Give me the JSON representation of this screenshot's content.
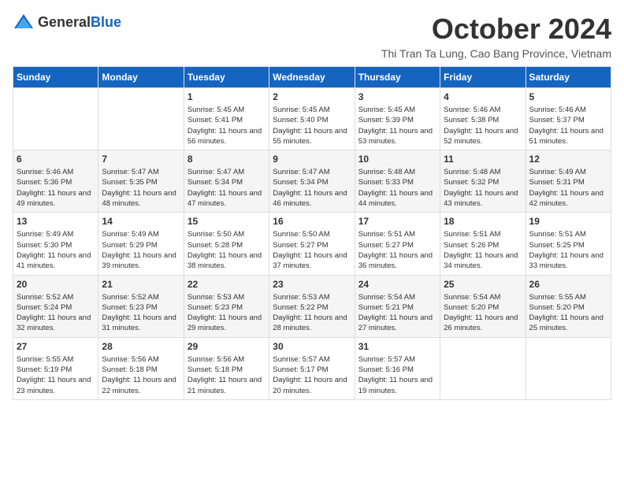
{
  "logo": {
    "general": "General",
    "blue": "Blue"
  },
  "header": {
    "month": "October 2024",
    "location": "Thi Tran Ta Lung, Cao Bang Province, Vietnam"
  },
  "days_of_week": [
    "Sunday",
    "Monday",
    "Tuesday",
    "Wednesday",
    "Thursday",
    "Friday",
    "Saturday"
  ],
  "weeks": [
    [
      {
        "day": "",
        "info": ""
      },
      {
        "day": "",
        "info": ""
      },
      {
        "day": "1",
        "info": "Sunrise: 5:45 AM\nSunset: 5:41 PM\nDaylight: 11 hours and 56 minutes."
      },
      {
        "day": "2",
        "info": "Sunrise: 5:45 AM\nSunset: 5:40 PM\nDaylight: 11 hours and 55 minutes."
      },
      {
        "day": "3",
        "info": "Sunrise: 5:45 AM\nSunset: 5:39 PM\nDaylight: 11 hours and 53 minutes."
      },
      {
        "day": "4",
        "info": "Sunrise: 5:46 AM\nSunset: 5:38 PM\nDaylight: 11 hours and 52 minutes."
      },
      {
        "day": "5",
        "info": "Sunrise: 5:46 AM\nSunset: 5:37 PM\nDaylight: 11 hours and 51 minutes."
      }
    ],
    [
      {
        "day": "6",
        "info": "Sunrise: 5:46 AM\nSunset: 5:36 PM\nDaylight: 11 hours and 49 minutes."
      },
      {
        "day": "7",
        "info": "Sunrise: 5:47 AM\nSunset: 5:35 PM\nDaylight: 11 hours and 48 minutes."
      },
      {
        "day": "8",
        "info": "Sunrise: 5:47 AM\nSunset: 5:34 PM\nDaylight: 11 hours and 47 minutes."
      },
      {
        "day": "9",
        "info": "Sunrise: 5:47 AM\nSunset: 5:34 PM\nDaylight: 11 hours and 46 minutes."
      },
      {
        "day": "10",
        "info": "Sunrise: 5:48 AM\nSunset: 5:33 PM\nDaylight: 11 hours and 44 minutes."
      },
      {
        "day": "11",
        "info": "Sunrise: 5:48 AM\nSunset: 5:32 PM\nDaylight: 11 hours and 43 minutes."
      },
      {
        "day": "12",
        "info": "Sunrise: 5:49 AM\nSunset: 5:31 PM\nDaylight: 11 hours and 42 minutes."
      }
    ],
    [
      {
        "day": "13",
        "info": "Sunrise: 5:49 AM\nSunset: 5:30 PM\nDaylight: 11 hours and 41 minutes."
      },
      {
        "day": "14",
        "info": "Sunrise: 5:49 AM\nSunset: 5:29 PM\nDaylight: 11 hours and 39 minutes."
      },
      {
        "day": "15",
        "info": "Sunrise: 5:50 AM\nSunset: 5:28 PM\nDaylight: 11 hours and 38 minutes."
      },
      {
        "day": "16",
        "info": "Sunrise: 5:50 AM\nSunset: 5:27 PM\nDaylight: 11 hours and 37 minutes."
      },
      {
        "day": "17",
        "info": "Sunrise: 5:51 AM\nSunset: 5:27 PM\nDaylight: 11 hours and 36 minutes."
      },
      {
        "day": "18",
        "info": "Sunrise: 5:51 AM\nSunset: 5:26 PM\nDaylight: 11 hours and 34 minutes."
      },
      {
        "day": "19",
        "info": "Sunrise: 5:51 AM\nSunset: 5:25 PM\nDaylight: 11 hours and 33 minutes."
      }
    ],
    [
      {
        "day": "20",
        "info": "Sunrise: 5:52 AM\nSunset: 5:24 PM\nDaylight: 11 hours and 32 minutes."
      },
      {
        "day": "21",
        "info": "Sunrise: 5:52 AM\nSunset: 5:23 PM\nDaylight: 11 hours and 31 minutes."
      },
      {
        "day": "22",
        "info": "Sunrise: 5:53 AM\nSunset: 5:23 PM\nDaylight: 11 hours and 29 minutes."
      },
      {
        "day": "23",
        "info": "Sunrise: 5:53 AM\nSunset: 5:22 PM\nDaylight: 11 hours and 28 minutes."
      },
      {
        "day": "24",
        "info": "Sunrise: 5:54 AM\nSunset: 5:21 PM\nDaylight: 11 hours and 27 minutes."
      },
      {
        "day": "25",
        "info": "Sunrise: 5:54 AM\nSunset: 5:20 PM\nDaylight: 11 hours and 26 minutes."
      },
      {
        "day": "26",
        "info": "Sunrise: 5:55 AM\nSunset: 5:20 PM\nDaylight: 11 hours and 25 minutes."
      }
    ],
    [
      {
        "day": "27",
        "info": "Sunrise: 5:55 AM\nSunset: 5:19 PM\nDaylight: 11 hours and 23 minutes."
      },
      {
        "day": "28",
        "info": "Sunrise: 5:56 AM\nSunset: 5:18 PM\nDaylight: 11 hours and 22 minutes."
      },
      {
        "day": "29",
        "info": "Sunrise: 5:56 AM\nSunset: 5:18 PM\nDaylight: 11 hours and 21 minutes."
      },
      {
        "day": "30",
        "info": "Sunrise: 5:57 AM\nSunset: 5:17 PM\nDaylight: 11 hours and 20 minutes."
      },
      {
        "day": "31",
        "info": "Sunrise: 5:57 AM\nSunset: 5:16 PM\nDaylight: 11 hours and 19 minutes."
      },
      {
        "day": "",
        "info": ""
      },
      {
        "day": "",
        "info": ""
      }
    ]
  ]
}
